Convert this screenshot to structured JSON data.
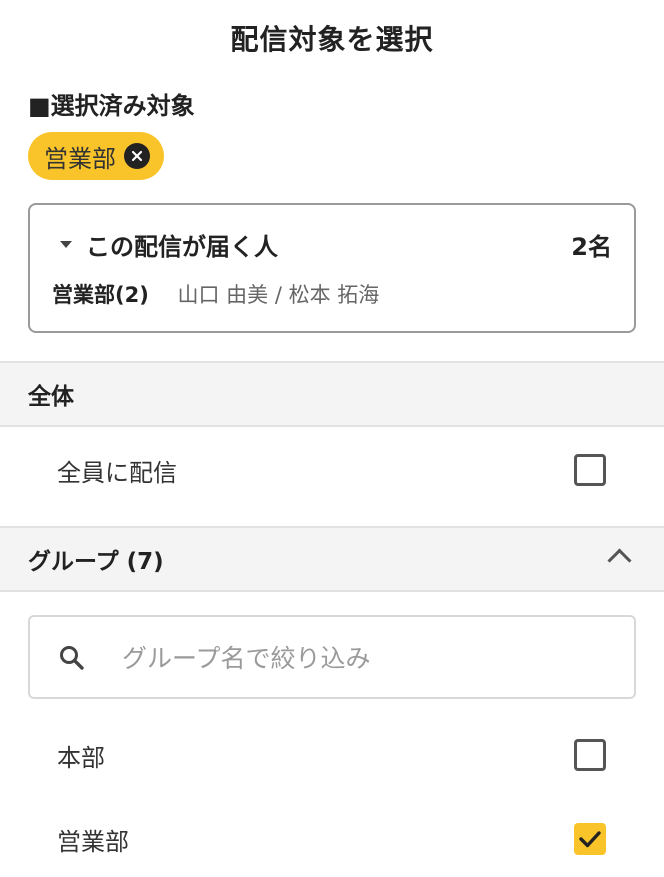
{
  "title": "配信対象を選択",
  "selected": {
    "label": "■選択済み対象",
    "chips": [
      {
        "label": "営業部"
      }
    ]
  },
  "recipients": {
    "header": "この配信が届く人",
    "count": "2名",
    "group": "営業部(2)",
    "members": "山口 由美 / 松本 拓海"
  },
  "sections": {
    "all": {
      "title": "全体",
      "items": [
        {
          "label": "全員に配信",
          "checked": false
        }
      ]
    },
    "groups": {
      "title": "グループ (7)",
      "search_placeholder": "グループ名で絞り込み",
      "items": [
        {
          "label": "本部",
          "checked": false
        },
        {
          "label": "営業部",
          "checked": true
        }
      ]
    }
  },
  "colors": {
    "accent": "#f9c42a",
    "section_bg": "#f4f4f4"
  }
}
